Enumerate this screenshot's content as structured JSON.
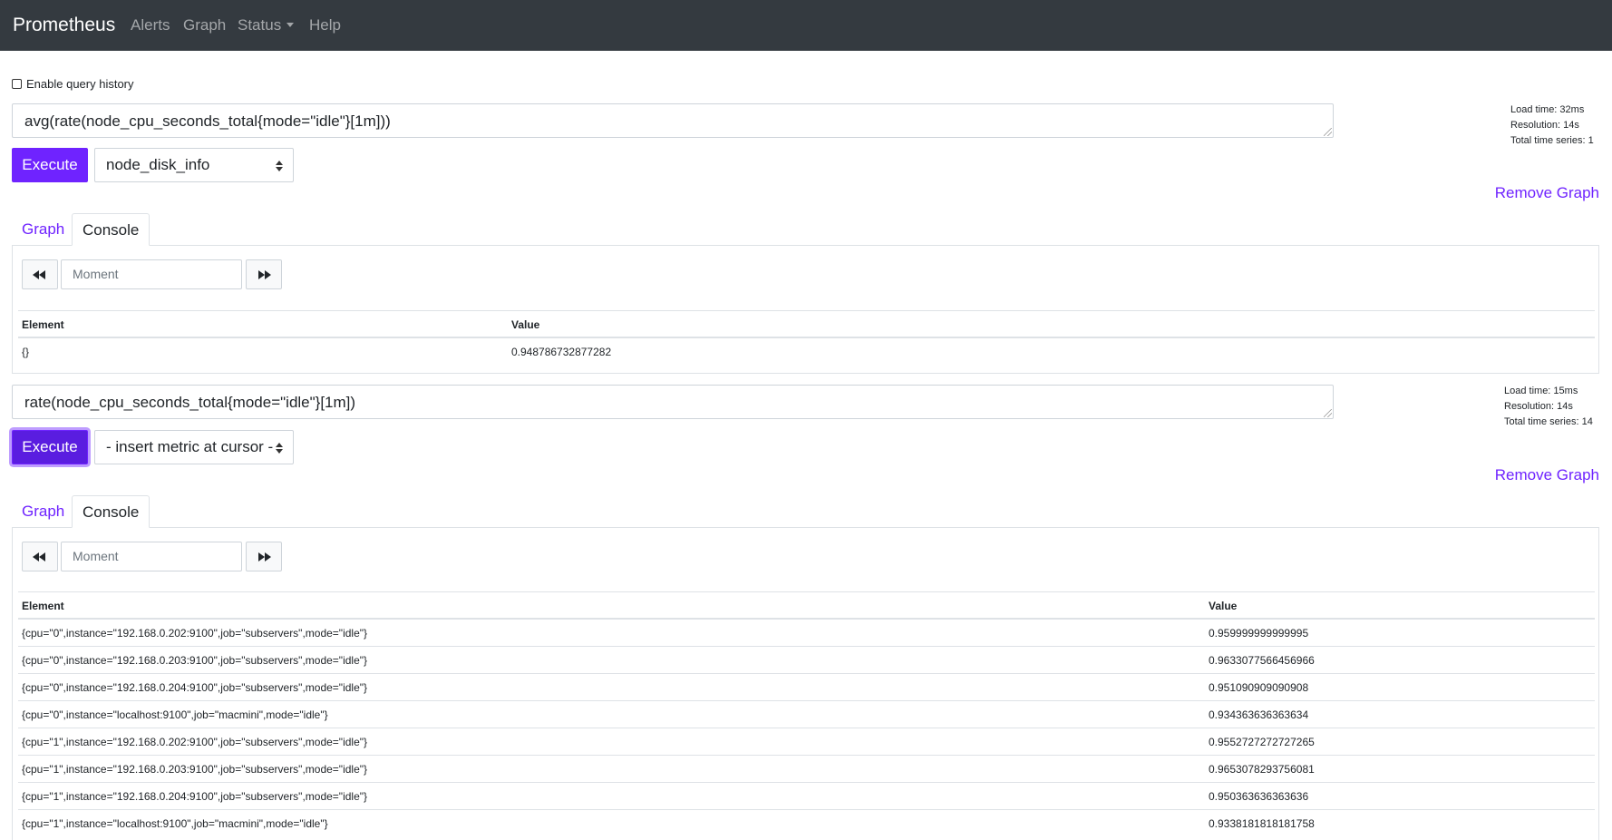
{
  "navbar": {
    "brand": "Prometheus",
    "links": [
      "Alerts",
      "Graph",
      "Status",
      "Help"
    ]
  },
  "history": {
    "label": "Enable query history",
    "checked": false
  },
  "panels": [
    {
      "expression": "avg(rate(node_cpu_seconds_total{mode=\"idle\"}[1m]))",
      "stats": {
        "load_time": "Load time: 32ms",
        "resolution": "Resolution: 14s",
        "total_series": "Total time series: 1"
      },
      "execute_label": "Execute",
      "metric_select": "node_disk_info",
      "remove_label": "Remove Graph",
      "tabs": [
        "Graph",
        "Console"
      ],
      "active_tab": "Console",
      "moment_placeholder": "Moment",
      "columns": [
        "Element",
        "Value"
      ],
      "rows": [
        {
          "element": "{}",
          "value": "0.948786732877282"
        }
      ]
    },
    {
      "expression": "rate(node_cpu_seconds_total{mode=\"idle\"}[1m])",
      "stats": {
        "load_time": "Load time: 15ms",
        "resolution": "Resolution: 14s",
        "total_series": "Total time series: 14"
      },
      "execute_label": "Execute",
      "metric_select": "- insert metric at cursor -",
      "remove_label": "Remove Graph",
      "tabs": [
        "Graph",
        "Console"
      ],
      "active_tab": "Console",
      "moment_placeholder": "Moment",
      "columns": [
        "Element",
        "Value"
      ],
      "rows": [
        {
          "element": "{cpu=\"0\",instance=\"192.168.0.202:9100\",job=\"subservers\",mode=\"idle\"}",
          "value": "0.959999999999995"
        },
        {
          "element": "{cpu=\"0\",instance=\"192.168.0.203:9100\",job=\"subservers\",mode=\"idle\"}",
          "value": "0.9633077566456966"
        },
        {
          "element": "{cpu=\"0\",instance=\"192.168.0.204:9100\",job=\"subservers\",mode=\"idle\"}",
          "value": "0.951090909090908"
        },
        {
          "element": "{cpu=\"0\",instance=\"localhost:9100\",job=\"macmini\",mode=\"idle\"}",
          "value": "0.934363636363634"
        },
        {
          "element": "{cpu=\"1\",instance=\"192.168.0.202:9100\",job=\"subservers\",mode=\"idle\"}",
          "value": "0.9552727272727265"
        },
        {
          "element": "{cpu=\"1\",instance=\"192.168.0.203:9100\",job=\"subservers\",mode=\"idle\"}",
          "value": "0.9653078293756081"
        },
        {
          "element": "{cpu=\"1\",instance=\"192.168.0.204:9100\",job=\"subservers\",mode=\"idle\"}",
          "value": "0.950363636363636"
        },
        {
          "element": "{cpu=\"1\",instance=\"localhost:9100\",job=\"macmini\",mode=\"idle\"}",
          "value": "0.9338181818181758"
        }
      ]
    }
  ],
  "colors": {
    "navbar": "#343a40",
    "accent": "#6f23ff"
  }
}
